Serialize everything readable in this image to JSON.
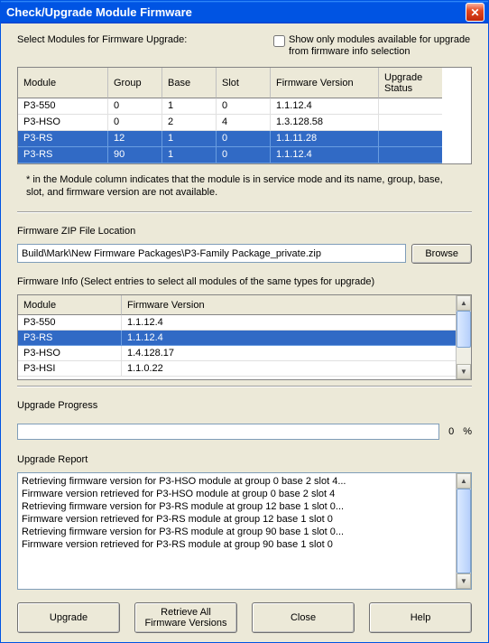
{
  "window": {
    "title": "Check/Upgrade Module Firmware"
  },
  "top": {
    "select_label": "Select Modules for Firmware Upgrade:",
    "show_only_label": "Show only modules available for upgrade from firmware info selection",
    "show_only_checked": false
  },
  "mods_table": {
    "headers": [
      "Module",
      "Group",
      "Base",
      "Slot",
      "Firmware Version",
      "Upgrade Status"
    ],
    "rows": [
      {
        "module": "P3-550",
        "group": "0",
        "base": "1",
        "slot": "0",
        "fw": "1.1.12.4",
        "status": "",
        "selected": false
      },
      {
        "module": "P3-HSO",
        "group": "0",
        "base": "2",
        "slot": "4",
        "fw": "1.3.128.58",
        "status": "",
        "selected": false
      },
      {
        "module": "P3-RS",
        "group": "12",
        "base": "1",
        "slot": "0",
        "fw": "1.1.11.28",
        "status": "",
        "selected": true
      },
      {
        "module": "P3-RS",
        "group": "90",
        "base": "1",
        "slot": "0",
        "fw": "1.1.12.4",
        "status": "",
        "selected": true
      }
    ],
    "footnote": "* in the Module column indicates that the module is in service mode and its name, group, base, slot, and firmware version are not available."
  },
  "zip": {
    "label": "Firmware ZIP File Location",
    "value": "Build\\Mark\\New Firmware Packages\\P3-Family Package_private.zip",
    "browse": "Browse"
  },
  "fw_info": {
    "label": "Firmware Info (Select entries to select all modules of the same types for upgrade)",
    "headers": [
      "Module",
      "Firmware Version"
    ],
    "rows": [
      {
        "module": "P3-550",
        "fw": "1.1.12.4",
        "selected": false
      },
      {
        "module": "P3-RS",
        "fw": "1.1.12.4",
        "selected": true
      },
      {
        "module": "P3-HSO",
        "fw": "1.4.128.17",
        "selected": false
      },
      {
        "module": "P3-HSI",
        "fw": "1.1.0.22",
        "selected": false
      }
    ]
  },
  "progress": {
    "label": "Upgrade Progress",
    "percent_value": "0",
    "percent_sign": "%"
  },
  "report": {
    "label": "Upgrade Report",
    "lines": [
      "Retrieving firmware version for P3-HSO module at group 0 base 2 slot 4...",
      "Firmware version retrieved for P3-HSO module at group 0 base 2 slot 4",
      "Retrieving firmware version for P3-RS module at group 12 base 1 slot 0...",
      "Firmware version retrieved for P3-RS module at group 12 base 1 slot 0",
      "Retrieving firmware version for P3-RS module at group 90 base 1 slot 0...",
      "Firmware version retrieved for P3-RS module at group 90 base 1 slot 0"
    ]
  },
  "buttons": {
    "upgrade": "Upgrade",
    "retrieve": "Retrieve All Firmware Versions",
    "close": "Close",
    "help": "Help"
  }
}
